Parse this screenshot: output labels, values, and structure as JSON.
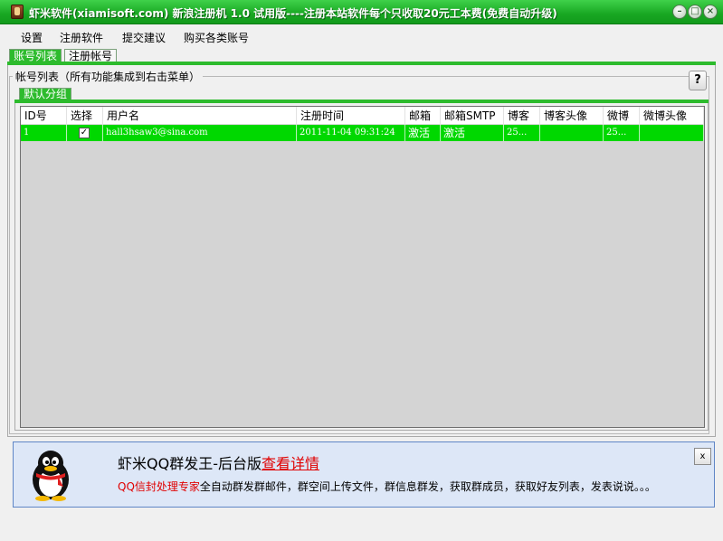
{
  "window": {
    "title": "虾米软件(xiamisoft.com) 新浪注册机 1.0 试用版----注册本站软件每个只收取20元工本费(免费自动升级)",
    "minimize": "–",
    "maximize": "□",
    "close": "×"
  },
  "menu": [
    "设置",
    "注册软件",
    "提交建议",
    "购买各类账号"
  ],
  "tabs": [
    "账号列表",
    "注册帐号"
  ],
  "group": {
    "title": "帐号列表（所有功能集成到右击菜单）",
    "help": "?"
  },
  "inner_tab": "默认分组",
  "grid": {
    "columns": [
      "ID号",
      "选择",
      "用户名",
      "注册时间",
      "邮箱",
      "邮箱SMTP",
      "博客",
      "博客头像",
      "微博",
      "微博头像"
    ],
    "rows": [
      {
        "id": "1",
        "checked": "✓",
        "username": "hall3hsaw3@sina.com",
        "reg_time": "2011-11-04 09:31:24",
        "mail": "激活",
        "smtp": "激活",
        "blog": "25...",
        "blog_avatar": "",
        "weibo": "25...",
        "weibo_avatar": ""
      }
    ]
  },
  "ad": {
    "title": "虾米QQ群发王-后台版",
    "link": "查看详情",
    "desc_red": "QQ信封处理专家",
    "desc": "全自动群发群邮件，群空间上传文件，群信息群发，获取群成员，获取好友列表，发表说说。。。",
    "close": "x"
  },
  "colors": {
    "accent_green": "#2dbb2d",
    "row_green": "#00d800",
    "ad_bg": "#dde7f7",
    "link_red": "#e00000"
  }
}
